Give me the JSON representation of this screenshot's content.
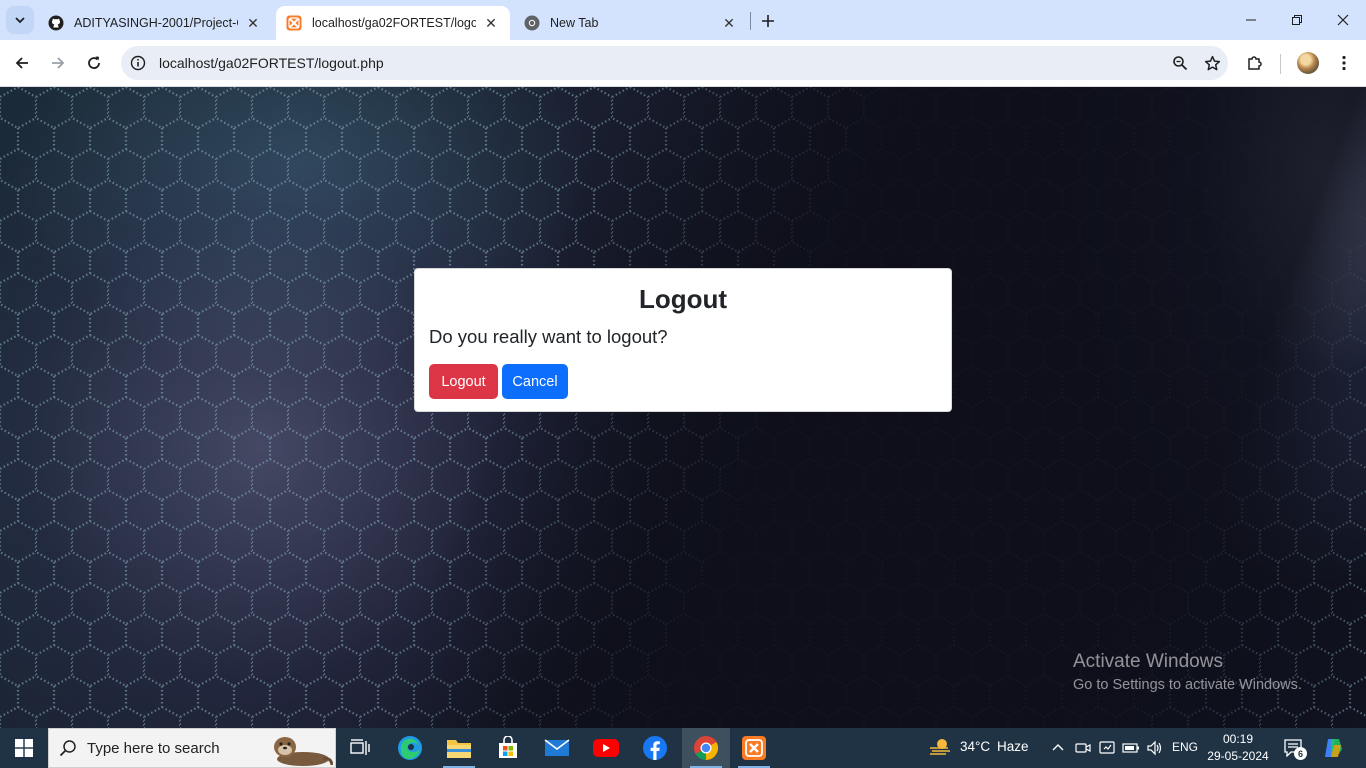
{
  "browser": {
    "tabs": [
      {
        "title": "ADITYASINGH-2001/Project-Ca",
        "favicon": "github-icon",
        "active": false
      },
      {
        "title": "localhost/ga02FORTEST/logout",
        "favicon": "xampp-icon",
        "active": true
      },
      {
        "title": "New Tab",
        "favicon": "chrome-icon",
        "active": false
      }
    ],
    "url": "localhost/ga02FORTEST/logout.php"
  },
  "modal": {
    "title": "Logout",
    "message": "Do you really want to logout?",
    "logout_label": "Logout",
    "cancel_label": "Cancel"
  },
  "watermark": {
    "line1": "Activate Windows",
    "line2": "Go to Settings to activate Windows."
  },
  "taskbar": {
    "search_placeholder": "Type here to search",
    "weather_temp": "34°C",
    "weather_desc": "Haze",
    "language": "ENG",
    "time": "00:19",
    "date": "29-05-2024",
    "notification_count": "6"
  },
  "colors": {
    "danger": "#dc3545",
    "primary": "#0d6efd",
    "tabstrip": "#d3e3fd",
    "taskbar": "#1f3344"
  }
}
